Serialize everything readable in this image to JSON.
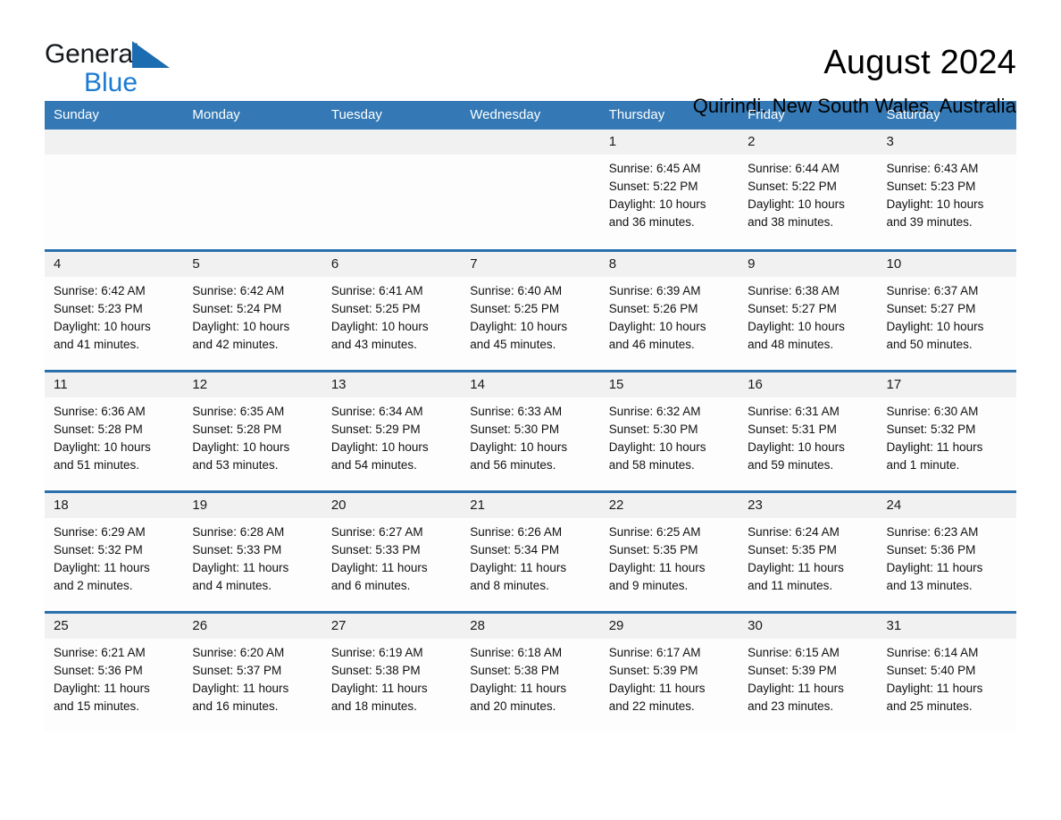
{
  "brand": {
    "name_part1": "General",
    "name_part2": "Blue",
    "triangle_color": "#1b6cb0",
    "blue_color": "#1b7ad1"
  },
  "header": {
    "title": "August 2024",
    "subtitle": "Quirindi, New South Wales, Australia"
  },
  "calendar": {
    "header_bg": "#3479b5",
    "row_divider": "#2a70ad",
    "daynum_bg": "#f1f1f1",
    "weekdays": [
      "Sunday",
      "Monday",
      "Tuesday",
      "Wednesday",
      "Thursday",
      "Friday",
      "Saturday"
    ],
    "weeks": [
      [
        {
          "day": "",
          "empty": true
        },
        {
          "day": "",
          "empty": true
        },
        {
          "day": "",
          "empty": true
        },
        {
          "day": "",
          "empty": true
        },
        {
          "day": "1",
          "sunrise": "Sunrise: 6:45 AM",
          "sunset": "Sunset: 5:22 PM",
          "daylight_line1": "Daylight: 10 hours",
          "daylight_line2": "and 36 minutes."
        },
        {
          "day": "2",
          "sunrise": "Sunrise: 6:44 AM",
          "sunset": "Sunset: 5:22 PM",
          "daylight_line1": "Daylight: 10 hours",
          "daylight_line2": "and 38 minutes."
        },
        {
          "day": "3",
          "sunrise": "Sunrise: 6:43 AM",
          "sunset": "Sunset: 5:23 PM",
          "daylight_line1": "Daylight: 10 hours",
          "daylight_line2": "and 39 minutes."
        }
      ],
      [
        {
          "day": "4",
          "sunrise": "Sunrise: 6:42 AM",
          "sunset": "Sunset: 5:23 PM",
          "daylight_line1": "Daylight: 10 hours",
          "daylight_line2": "and 41 minutes."
        },
        {
          "day": "5",
          "sunrise": "Sunrise: 6:42 AM",
          "sunset": "Sunset: 5:24 PM",
          "daylight_line1": "Daylight: 10 hours",
          "daylight_line2": "and 42 minutes."
        },
        {
          "day": "6",
          "sunrise": "Sunrise: 6:41 AM",
          "sunset": "Sunset: 5:25 PM",
          "daylight_line1": "Daylight: 10 hours",
          "daylight_line2": "and 43 minutes."
        },
        {
          "day": "7",
          "sunrise": "Sunrise: 6:40 AM",
          "sunset": "Sunset: 5:25 PM",
          "daylight_line1": "Daylight: 10 hours",
          "daylight_line2": "and 45 minutes."
        },
        {
          "day": "8",
          "sunrise": "Sunrise: 6:39 AM",
          "sunset": "Sunset: 5:26 PM",
          "daylight_line1": "Daylight: 10 hours",
          "daylight_line2": "and 46 minutes."
        },
        {
          "day": "9",
          "sunrise": "Sunrise: 6:38 AM",
          "sunset": "Sunset: 5:27 PM",
          "daylight_line1": "Daylight: 10 hours",
          "daylight_line2": "and 48 minutes."
        },
        {
          "day": "10",
          "sunrise": "Sunrise: 6:37 AM",
          "sunset": "Sunset: 5:27 PM",
          "daylight_line1": "Daylight: 10 hours",
          "daylight_line2": "and 50 minutes."
        }
      ],
      [
        {
          "day": "11",
          "sunrise": "Sunrise: 6:36 AM",
          "sunset": "Sunset: 5:28 PM",
          "daylight_line1": "Daylight: 10 hours",
          "daylight_line2": "and 51 minutes."
        },
        {
          "day": "12",
          "sunrise": "Sunrise: 6:35 AM",
          "sunset": "Sunset: 5:28 PM",
          "daylight_line1": "Daylight: 10 hours",
          "daylight_line2": "and 53 minutes."
        },
        {
          "day": "13",
          "sunrise": "Sunrise: 6:34 AM",
          "sunset": "Sunset: 5:29 PM",
          "daylight_line1": "Daylight: 10 hours",
          "daylight_line2": "and 54 minutes."
        },
        {
          "day": "14",
          "sunrise": "Sunrise: 6:33 AM",
          "sunset": "Sunset: 5:30 PM",
          "daylight_line1": "Daylight: 10 hours",
          "daylight_line2": "and 56 minutes."
        },
        {
          "day": "15",
          "sunrise": "Sunrise: 6:32 AM",
          "sunset": "Sunset: 5:30 PM",
          "daylight_line1": "Daylight: 10 hours",
          "daylight_line2": "and 58 minutes."
        },
        {
          "day": "16",
          "sunrise": "Sunrise: 6:31 AM",
          "sunset": "Sunset: 5:31 PM",
          "daylight_line1": "Daylight: 10 hours",
          "daylight_line2": "and 59 minutes."
        },
        {
          "day": "17",
          "sunrise": "Sunrise: 6:30 AM",
          "sunset": "Sunset: 5:32 PM",
          "daylight_line1": "Daylight: 11 hours",
          "daylight_line2": "and 1 minute."
        }
      ],
      [
        {
          "day": "18",
          "sunrise": "Sunrise: 6:29 AM",
          "sunset": "Sunset: 5:32 PM",
          "daylight_line1": "Daylight: 11 hours",
          "daylight_line2": "and 2 minutes."
        },
        {
          "day": "19",
          "sunrise": "Sunrise: 6:28 AM",
          "sunset": "Sunset: 5:33 PM",
          "daylight_line1": "Daylight: 11 hours",
          "daylight_line2": "and 4 minutes."
        },
        {
          "day": "20",
          "sunrise": "Sunrise: 6:27 AM",
          "sunset": "Sunset: 5:33 PM",
          "daylight_line1": "Daylight: 11 hours",
          "daylight_line2": "and 6 minutes."
        },
        {
          "day": "21",
          "sunrise": "Sunrise: 6:26 AM",
          "sunset": "Sunset: 5:34 PM",
          "daylight_line1": "Daylight: 11 hours",
          "daylight_line2": "and 8 minutes."
        },
        {
          "day": "22",
          "sunrise": "Sunrise: 6:25 AM",
          "sunset": "Sunset: 5:35 PM",
          "daylight_line1": "Daylight: 11 hours",
          "daylight_line2": "and 9 minutes."
        },
        {
          "day": "23",
          "sunrise": "Sunrise: 6:24 AM",
          "sunset": "Sunset: 5:35 PM",
          "daylight_line1": "Daylight: 11 hours",
          "daylight_line2": "and 11 minutes."
        },
        {
          "day": "24",
          "sunrise": "Sunrise: 6:23 AM",
          "sunset": "Sunset: 5:36 PM",
          "daylight_line1": "Daylight: 11 hours",
          "daylight_line2": "and 13 minutes."
        }
      ],
      [
        {
          "day": "25",
          "sunrise": "Sunrise: 6:21 AM",
          "sunset": "Sunset: 5:36 PM",
          "daylight_line1": "Daylight: 11 hours",
          "daylight_line2": "and 15 minutes."
        },
        {
          "day": "26",
          "sunrise": "Sunrise: 6:20 AM",
          "sunset": "Sunset: 5:37 PM",
          "daylight_line1": "Daylight: 11 hours",
          "daylight_line2": "and 16 minutes."
        },
        {
          "day": "27",
          "sunrise": "Sunrise: 6:19 AM",
          "sunset": "Sunset: 5:38 PM",
          "daylight_line1": "Daylight: 11 hours",
          "daylight_line2": "and 18 minutes."
        },
        {
          "day": "28",
          "sunrise": "Sunrise: 6:18 AM",
          "sunset": "Sunset: 5:38 PM",
          "daylight_line1": "Daylight: 11 hours",
          "daylight_line2": "and 20 minutes."
        },
        {
          "day": "29",
          "sunrise": "Sunrise: 6:17 AM",
          "sunset": "Sunset: 5:39 PM",
          "daylight_line1": "Daylight: 11 hours",
          "daylight_line2": "and 22 minutes."
        },
        {
          "day": "30",
          "sunrise": "Sunrise: 6:15 AM",
          "sunset": "Sunset: 5:39 PM",
          "daylight_line1": "Daylight: 11 hours",
          "daylight_line2": "and 23 minutes."
        },
        {
          "day": "31",
          "sunrise": "Sunrise: 6:14 AM",
          "sunset": "Sunset: 5:40 PM",
          "daylight_line1": "Daylight: 11 hours",
          "daylight_line2": "and 25 minutes."
        }
      ]
    ]
  }
}
